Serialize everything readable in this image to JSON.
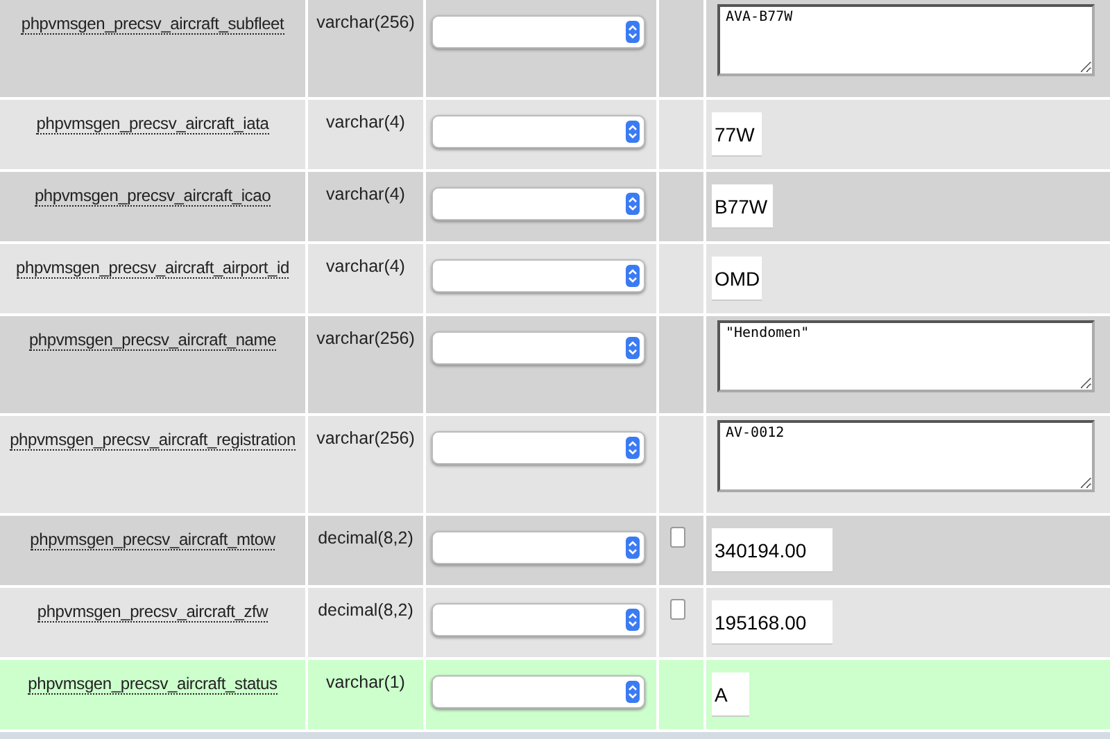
{
  "rows": [
    {
      "name": "phpvmsgen_precsv_aircraft_subfleet",
      "type": "varchar(256)",
      "marked": false,
      "field": {
        "kind": "textarea",
        "value": "AVA-B77W"
      }
    },
    {
      "name": "phpvmsgen_precsv_aircraft_iata",
      "type": "varchar(4)",
      "marked": false,
      "field": {
        "kind": "input",
        "value": "77W"
      }
    },
    {
      "name": "phpvmsgen_precsv_aircraft_icao",
      "type": "varchar(4)",
      "marked": false,
      "field": {
        "kind": "input",
        "value": "B77W"
      }
    },
    {
      "name": "phpvmsgen_precsv_aircraft_airport_id",
      "type": "varchar(4)",
      "marked": false,
      "field": {
        "kind": "input",
        "value": "OMD"
      }
    },
    {
      "name": "phpvmsgen_precsv_aircraft_name",
      "type": "varchar(256)",
      "marked": false,
      "field": {
        "kind": "textarea",
        "value": "\"Hendomen\""
      }
    },
    {
      "name": "phpvmsgen_precsv_aircraft_registration",
      "type": "varchar(256)",
      "marked": false,
      "field": {
        "kind": "textarea",
        "value": "AV-0012"
      }
    },
    {
      "name": "phpvmsgen_precsv_aircraft_mtow",
      "type": "decimal(8,2)",
      "marked": false,
      "null_checkbox": {
        "checked": false
      },
      "field": {
        "kind": "input",
        "value": "340194.00"
      }
    },
    {
      "name": "phpvmsgen_precsv_aircraft_zfw",
      "type": "decimal(8,2)",
      "marked": false,
      "null_checkbox": {
        "checked": false
      },
      "field": {
        "kind": "input",
        "value": "195168.00"
      }
    },
    {
      "name": "phpvmsgen_precsv_aircraft_status",
      "type": "varchar(1)",
      "marked": true,
      "field": {
        "kind": "input",
        "value": "A"
      }
    }
  ]
}
